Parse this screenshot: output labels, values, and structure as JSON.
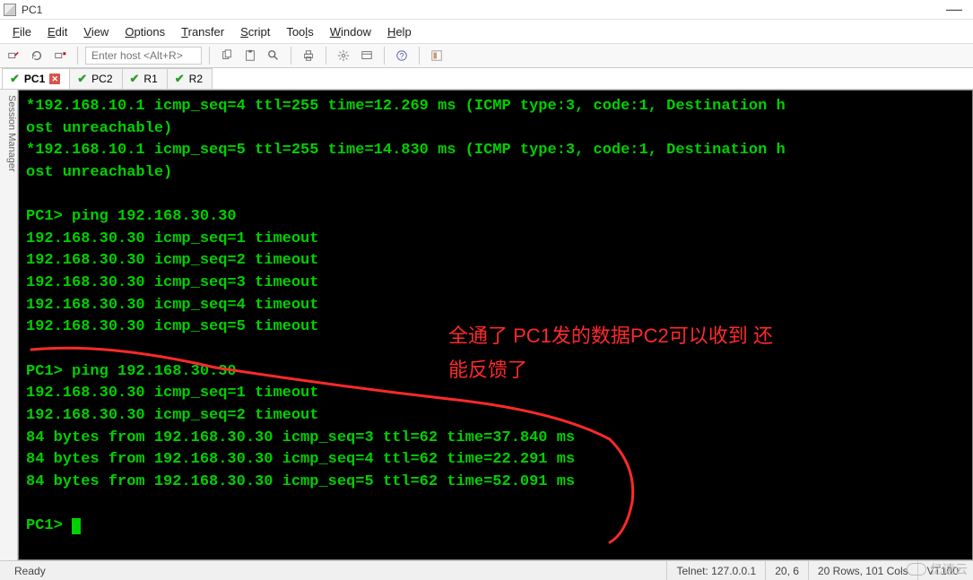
{
  "window": {
    "title": "PC1"
  },
  "menu": {
    "file": "File",
    "edit": "Edit",
    "view": "View",
    "options": "Options",
    "transfer": "Transfer",
    "script": "Script",
    "tools": "Tools",
    "window": "Window",
    "help": "Help"
  },
  "toolbar": {
    "host_placeholder": "Enter host <Alt+R>"
  },
  "tabs": [
    {
      "label": "PC1",
      "active": true,
      "closeable": true
    },
    {
      "label": "PC2",
      "active": false,
      "closeable": false
    },
    {
      "label": "R1",
      "active": false,
      "closeable": false
    },
    {
      "label": "R2",
      "active": false,
      "closeable": false
    }
  ],
  "side_panel": {
    "label": "Session Manager"
  },
  "terminal": {
    "lines": [
      "*192.168.10.1 icmp_seq=4 ttl=255 time=12.269 ms (ICMP type:3, code:1, Destination h",
      "ost unreachable)",
      "*192.168.10.1 icmp_seq=5 ttl=255 time=14.830 ms (ICMP type:3, code:1, Destination h",
      "ost unreachable)",
      "",
      "PC1> ping 192.168.30.30",
      "192.168.30.30 icmp_seq=1 timeout",
      "192.168.30.30 icmp_seq=2 timeout",
      "192.168.30.30 icmp_seq=3 timeout",
      "192.168.30.30 icmp_seq=4 timeout",
      "192.168.30.30 icmp_seq=5 timeout",
      "",
      "PC1> ping 192.168.30.30",
      "192.168.30.30 icmp_seq=1 timeout",
      "192.168.30.30 icmp_seq=2 timeout",
      "84 bytes from 192.168.30.30 icmp_seq=3 ttl=62 time=37.840 ms",
      "84 bytes from 192.168.30.30 icmp_seq=4 ttl=62 time=22.291 ms",
      "84 bytes from 192.168.30.30 icmp_seq=5 ttl=62 time=52.091 ms",
      "",
      "PC1> "
    ]
  },
  "annotation": {
    "text_line1": "全通了 PC1发的数据PC2可以收到 还",
    "text_line2": "能反馈了"
  },
  "statusbar": {
    "ready": "Ready",
    "conn": "Telnet: 127.0.0.1",
    "pos": "20,  6",
    "dims": "20 Rows, 101 Cols",
    "term": "VT100"
  },
  "watermark": {
    "text": "亿速云"
  }
}
